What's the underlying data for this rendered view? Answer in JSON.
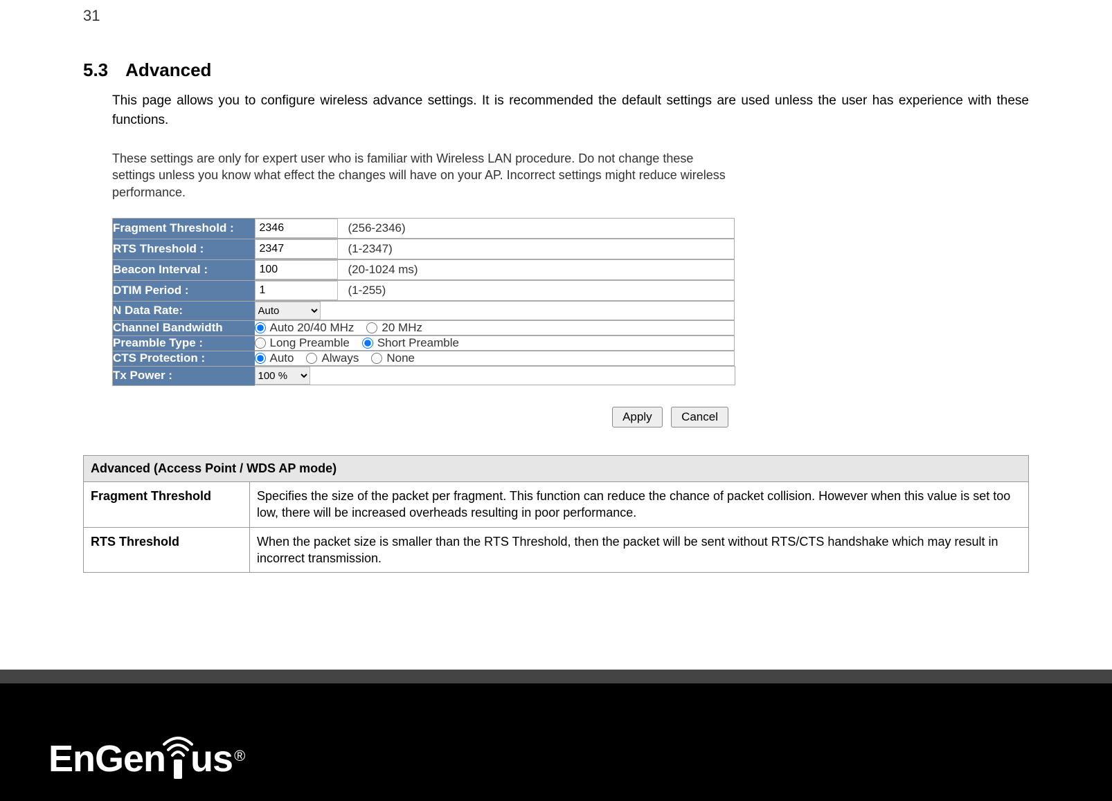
{
  "page_number": "31",
  "section": {
    "number": "5.3",
    "title": "Advanced"
  },
  "intro": "This page allows you to configure wireless advance settings. It is recommended the default settings are used unless the user has experience with these functions.",
  "warning": "These settings are only for expert user who is familiar with Wireless LAN procedure. Do not change these settings unless you know what effect the changes will have on your AP. Incorrect settings might reduce wireless performance.",
  "settings": {
    "fragment_threshold": {
      "label": "Fragment Threshold :",
      "value": "2346",
      "range": "(256-2346)"
    },
    "rts_threshold": {
      "label": "RTS Threshold :",
      "value": "2347",
      "range": "(1-2347)"
    },
    "beacon_interval": {
      "label": "Beacon Interval :",
      "value": "100",
      "range": "(20-1024 ms)"
    },
    "dtim_period": {
      "label": "DTIM Period :",
      "value": "1",
      "range": "(1-255)"
    },
    "n_data_rate": {
      "label": "N Data Rate:",
      "value": "Auto"
    },
    "channel_bandwidth": {
      "label": "Channel Bandwidth",
      "opt1": "Auto 20/40 MHz",
      "opt2": "20 MHz"
    },
    "preamble_type": {
      "label": "Preamble Type :",
      "opt1": "Long Preamble",
      "opt2": "Short Preamble"
    },
    "cts_protection": {
      "label": "CTS Protection :",
      "opt1": "Auto",
      "opt2": "Always",
      "opt3": "None"
    },
    "tx_power": {
      "label": "Tx Power :",
      "value": "100 %"
    }
  },
  "buttons": {
    "apply": "Apply",
    "cancel": "Cancel"
  },
  "desc_table": {
    "header": "Advanced (Access Point / WDS AP mode)",
    "rows": [
      {
        "label": "Fragment Threshold",
        "desc": "Specifies the size of the packet per fragment. This function can reduce the chance of packet collision. However when this value is set too low, there will be increased overheads resulting in poor performance."
      },
      {
        "label": "RTS Threshold",
        "desc": "When the packet size is smaller than the RTS Threshold, then the packet will be sent without RTS/CTS handshake which may result in incorrect transmission."
      }
    ]
  },
  "logo": {
    "part1": "EnGen",
    "part3": "us",
    "reg": "®"
  }
}
